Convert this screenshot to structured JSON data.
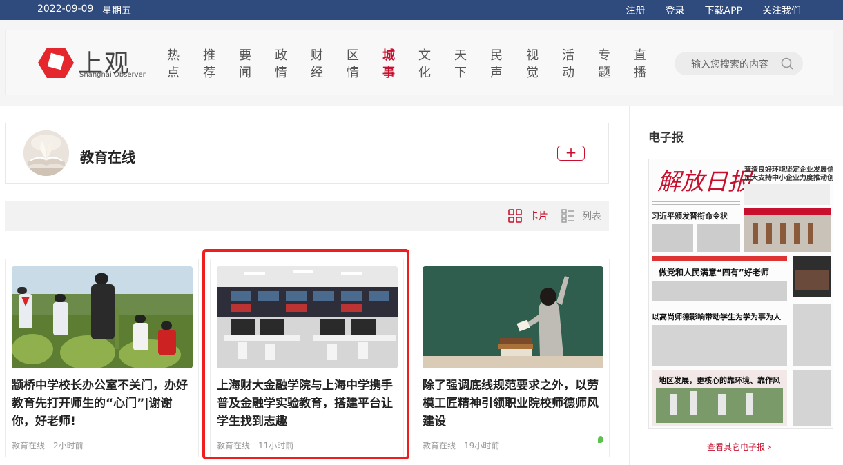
{
  "topbar": {
    "date": "2022-09-09",
    "weekday": "星期五",
    "links": [
      "注册",
      "登录",
      "下载APP",
      "关注我们"
    ]
  },
  "logo": {
    "cn": "上观",
    "en": "Shanghai Observer"
  },
  "nav": [
    {
      "l1": "热",
      "l2": "点"
    },
    {
      "l1": "推",
      "l2": "荐"
    },
    {
      "l1": "要",
      "l2": "闻"
    },
    {
      "l1": "政",
      "l2": "情"
    },
    {
      "l1": "财",
      "l2": "经"
    },
    {
      "l1": "区",
      "l2": "情"
    },
    {
      "l1": "城",
      "l2": "事",
      "active": true
    },
    {
      "l1": "文",
      "l2": "化"
    },
    {
      "l1": "天",
      "l2": "下"
    },
    {
      "l1": "民",
      "l2": "声"
    },
    {
      "l1": "视",
      "l2": "觉"
    },
    {
      "l1": "活",
      "l2": "动"
    },
    {
      "l1": "专",
      "l2": "题"
    },
    {
      "l1": "直",
      "l2": "播"
    }
  ],
  "search": {
    "placeholder": "输入您搜索的内容"
  },
  "channel": {
    "title": "教育在线"
  },
  "view": {
    "card_label": "卡片",
    "list_label": "列表"
  },
  "articles": [
    {
      "title": "颛桥中学校长办公室不关门，办好教育先打开师生的“心门”|谢谢你，好老师!",
      "source": "教育在线",
      "time": "2小时前"
    },
    {
      "title": "上海财大金融学院与上海中学携手普及金融学实验教育，搭建平台让学生找到志趣",
      "source": "教育在线",
      "time": "11小时前"
    },
    {
      "title": "除了强调底线规范要求之外，以劳模工匠精神引领职业院校师德师风建设",
      "source": "教育在线",
      "time": "19小时前"
    }
  ],
  "sidebar": {
    "heading": "电子报",
    "paper": {
      "masthead": "解放日报",
      "h1": "营造良好环境坚定企业发展信心",
      "h1b": "加大支持中小企业力度推动创新",
      "h2": "习近平颁发晋衔命令状",
      "h3": "做党和人民满意“四有”好老师",
      "h4": "以高尚师德影响带动学生为学为事为人",
      "h5": "地区发展，更核心的靠环境、靠作风"
    },
    "more": "查看其它电子报"
  },
  "colors": {
    "accent": "#c8102e",
    "topbar": "#2f4a7d",
    "highlight": "#f01d1d"
  }
}
